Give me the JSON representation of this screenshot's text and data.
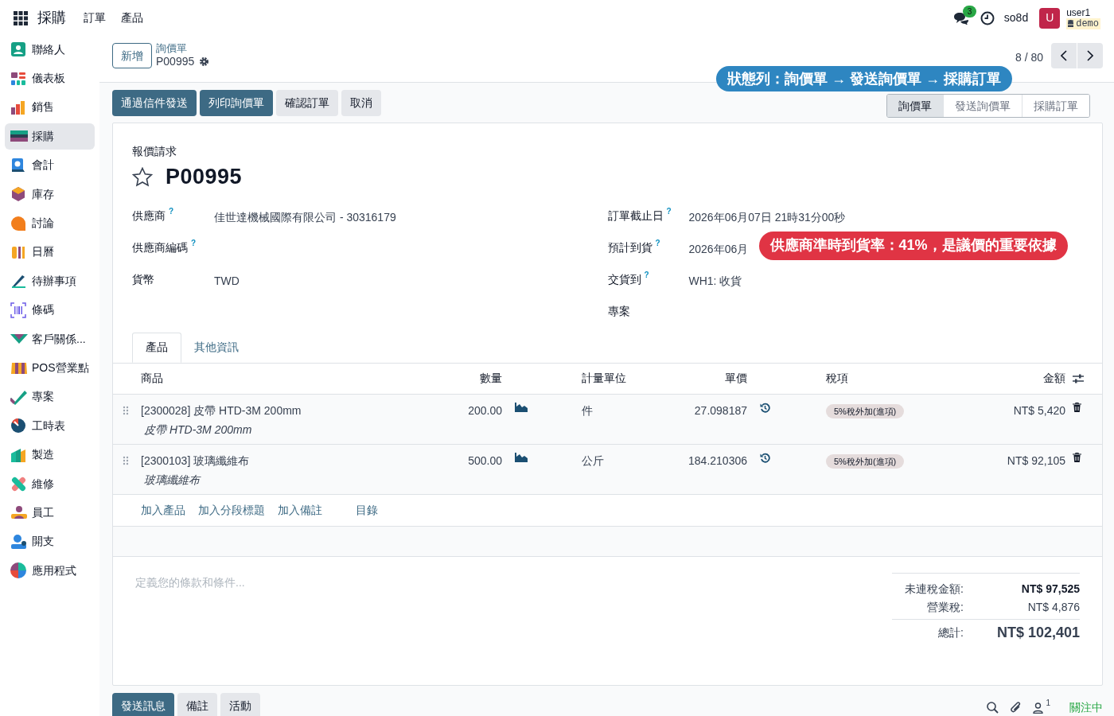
{
  "topbar": {
    "app": "採購",
    "menus": [
      "訂單",
      "產品"
    ],
    "message_count": "3",
    "db": "so8d",
    "avatar": "U",
    "user": "user1",
    "instance": "demo"
  },
  "sidebar": {
    "items": [
      {
        "label": "聯絡人",
        "selected": false
      },
      {
        "label": "儀表板",
        "selected": false
      },
      {
        "label": "銷售",
        "selected": false
      },
      {
        "label": "採購",
        "selected": true
      },
      {
        "label": "會計",
        "selected": false
      },
      {
        "label": "庫存",
        "selected": false
      },
      {
        "label": "討論",
        "selected": false
      },
      {
        "label": "日曆",
        "selected": false
      },
      {
        "label": "待辦事項",
        "selected": false
      },
      {
        "label": "條碼",
        "selected": false
      },
      {
        "label": "客戶關係...",
        "selected": false
      },
      {
        "label": "POS營業點",
        "selected": false
      },
      {
        "label": "專案",
        "selected": false
      },
      {
        "label": "工時表",
        "selected": false
      },
      {
        "label": "製造",
        "selected": false
      },
      {
        "label": "維修",
        "selected": false
      },
      {
        "label": "員工",
        "selected": false
      },
      {
        "label": "開支",
        "selected": false
      },
      {
        "label": "應用程式",
        "selected": false
      }
    ]
  },
  "control_panel": {
    "new_button": "新增",
    "breadcrumb": "詢價單",
    "record": "P00995",
    "pager": "8 / 80"
  },
  "actions": [
    {
      "label": "通過信件發送",
      "kind": "primary"
    },
    {
      "label": "列印詢價單",
      "kind": "primary"
    },
    {
      "label": "確認訂單",
      "kind": "secondary"
    },
    {
      "label": "取消",
      "kind": "secondary"
    }
  ],
  "status_bar": [
    {
      "label": "詢價單",
      "selected": true
    },
    {
      "label": "發送詢價單",
      "selected": false
    },
    {
      "label": "採購訂單",
      "selected": false
    }
  ],
  "callouts": [
    {
      "text": "狀態列：詢價單 → 發送詢價單 → 採購訂單",
      "color": "#2e86c1"
    },
    {
      "text": "供應商準時到貨率：41%，是議價的重要依據",
      "color": "#e03444"
    }
  ],
  "form": {
    "subtitle": "報價請求",
    "title": "P00995",
    "starred": false,
    "left_fields": [
      {
        "label": "供應商",
        "help": "?",
        "value": "佳世達機械國際有限公司 - 30316179"
      },
      {
        "label": "供應商編碼",
        "help": "?"
      },
      {
        "label": "貨幣",
        "value": "TWD"
      }
    ],
    "right_fields": [
      {
        "label": "訂單截止日",
        "help": "?",
        "value": "2026年06月07日 21時31分00秒"
      },
      {
        "label": "預計到貨",
        "help": "?",
        "value": "2026年06月"
      },
      {
        "label": "交貨到",
        "help": "?",
        "value": "WH1: 收貨"
      },
      {
        "label": "專案"
      }
    ],
    "tabs": [
      {
        "label": "產品",
        "selected": true
      },
      {
        "label": "其他資訊",
        "selected": false
      }
    ],
    "table": {
      "columns": [
        "商品",
        "數量",
        "計量單位",
        "單價",
        "稅項",
        "金額"
      ],
      "rows": [
        {
          "product": "[2300028] 皮帶 HTD-3M 200mm",
          "description": "皮帶 HTD-3M 200mm",
          "quantity": "200.00",
          "uom": "件",
          "price": "27.098187",
          "tax": "5%稅外加(進項)",
          "amount": "NT$ 5,420"
        },
        {
          "product": "[2300103] 玻璃纖維布",
          "description": "玻璃纖維布",
          "quantity": "500.00",
          "uom": "公斤",
          "price": "184.210306",
          "tax": "5%稅外加(進項)",
          "amount": "NT$ 92,105"
        }
      ],
      "add_links": [
        "加入產品",
        "加入分段標題",
        "加入備註",
        "目錄"
      ]
    },
    "terms_placeholder": "定義您的條款和條件...",
    "totals": [
      {
        "label": "未連稅金額:",
        "value": "NT$ 97,525",
        "kind": "bold"
      },
      {
        "label": "營業稅:",
        "value": "NT$ 4,876",
        "kind": "normal"
      },
      {
        "label": "總計:",
        "value": "NT$ 102,401",
        "kind": "total"
      }
    ]
  },
  "chatter": {
    "buttons": [
      {
        "label": "發送訊息",
        "selected": true
      },
      {
        "label": "備註",
        "selected": false
      },
      {
        "label": "活動",
        "selected": false
      }
    ],
    "followers": "1",
    "follow": "關注中"
  }
}
